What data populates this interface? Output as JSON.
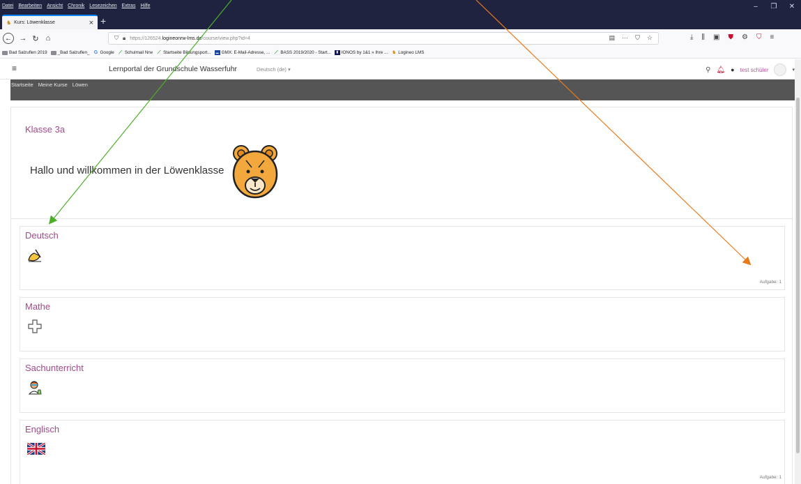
{
  "browser": {
    "menu": [
      "Datei",
      "Bearbeiten",
      "Ansicht",
      "Chronik",
      "Lesezeichen",
      "Extras",
      "Hilfe"
    ],
    "tab_title": "Kurs: Löwenklasse",
    "url_prefix": "https://126524.",
    "url_domain": "logineonrw-lms.de",
    "url_path": "/course/view.php?id=4",
    "bookmarks": [
      {
        "label": "Bad Salzuflen 2019",
        "icon": "folder-icon"
      },
      {
        "label": "_Bad Salzuflen_",
        "icon": "folder-icon"
      },
      {
        "label": "Google",
        "icon": "google-icon"
      },
      {
        "label": "Schulmail Nrw",
        "icon": "nrw-icon"
      },
      {
        "label": "Startseite Bildungsport...",
        "icon": "nrw-icon"
      },
      {
        "label": "GMX: E-Mail-Adresse, ...",
        "icon": "gmx-icon"
      },
      {
        "label": "BASS 2019/2020 - Start...",
        "icon": "nrw-icon"
      },
      {
        "label": "IONOS by 1&1 » Ihre ...",
        "icon": "ionos-icon"
      },
      {
        "label": "Logineo LMS",
        "icon": "logineo-icon"
      }
    ]
  },
  "header": {
    "site_title": "Lernportal der Grundschule Wasserfuhr",
    "language": "Deutsch (de) ▾",
    "user_name": "test schüler"
  },
  "breadcrumb": [
    "Startseite",
    "Meine Kurse",
    "Löwen"
  ],
  "course": {
    "title": "Klasse 3a",
    "welcome": "Hallo und willkommen in der Löwenklasse"
  },
  "sections": [
    {
      "name": "Deutsch",
      "count": "Aufgabe: 1",
      "icon": "writing-hand-icon"
    },
    {
      "name": "Mathe",
      "count": "",
      "icon": "plus-icon"
    },
    {
      "name": "Sachunterricht",
      "count": "",
      "icon": "scientist-icon"
    },
    {
      "name": "Englisch",
      "count": "Aufgabe: 1",
      "icon": "uk-flag-icon"
    }
  ],
  "colors": {
    "section_title": "#a04a8a",
    "breadcrumb_band": "#555555",
    "arrow_green": "#4caf2a",
    "arrow_orange": "#e87a1e"
  }
}
